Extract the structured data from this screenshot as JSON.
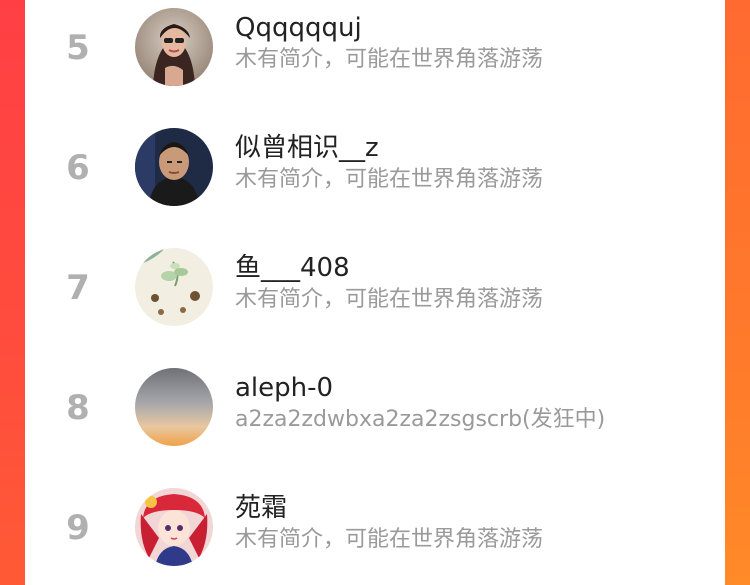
{
  "users": [
    {
      "rank": "5",
      "name": "Qqqqqquj",
      "bio": "木有简介，可能在世界角落游荡",
      "avatar_icon": "avatar-woman-sunglasses"
    },
    {
      "rank": "6",
      "name": "似曾相识__z",
      "bio": "木有简介，可能在世界角落游荡",
      "avatar_icon": "avatar-man-dark-background"
    },
    {
      "rank": "7",
      "name": "鱼___408",
      "bio": "木有简介，可能在世界角落游荡",
      "avatar_icon": "avatar-plant-sprout"
    },
    {
      "rank": "8",
      "name": "aleph-0",
      "bio": "a2za2zdwbxa2za2zsgscrb(发狂中)",
      "avatar_icon": "avatar-sunset-gradient"
    },
    {
      "rank": "9",
      "name": "苑霜",
      "bio": "木有简介，可能在世界角落游荡",
      "avatar_icon": "avatar-anime-girl-red"
    }
  ],
  "colors": {
    "rank": "#b0b0b0",
    "name": "#222222",
    "bio": "#9a9a9a",
    "accent_left": "#ff4a3f",
    "accent_right": "#ff7a2e"
  }
}
